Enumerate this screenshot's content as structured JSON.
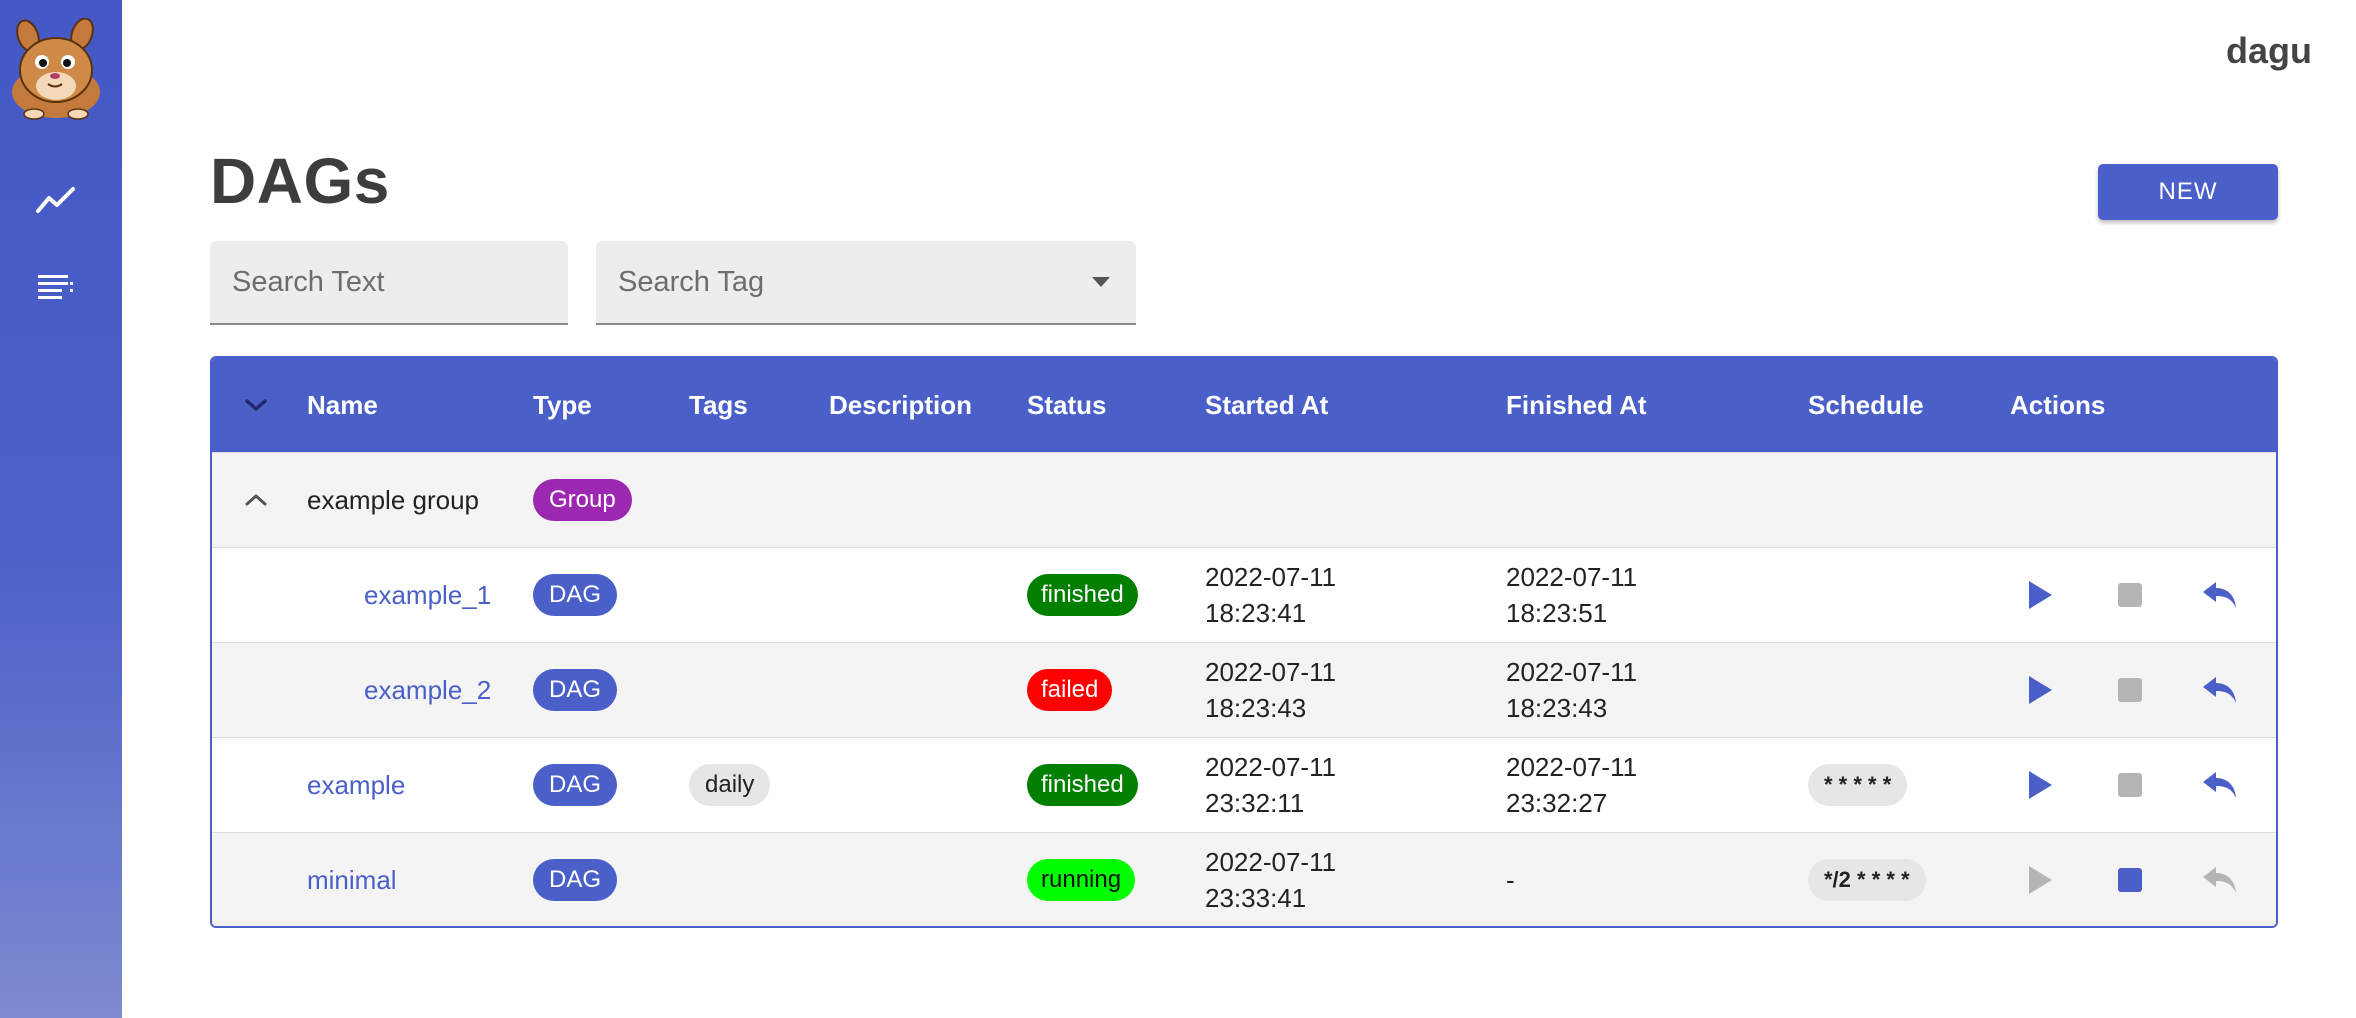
{
  "app": {
    "brand": "dagu"
  },
  "page": {
    "title": "DAGs",
    "new_button": "NEW"
  },
  "search": {
    "text_placeholder": "Search Text",
    "tag_placeholder": "Search Tag"
  },
  "table": {
    "columns": [
      "Name",
      "Type",
      "Tags",
      "Description",
      "Status",
      "Started At",
      "Finished At",
      "Schedule",
      "Actions"
    ],
    "group": {
      "name": "example group",
      "type": "Group"
    },
    "rows": [
      {
        "name": "example_1",
        "type": "DAG",
        "tags": "",
        "status": "finished",
        "started_date": "2022-07-11",
        "started_time": "18:23:41",
        "finished_date": "2022-07-11",
        "finished_time": "18:23:51",
        "schedule": ""
      },
      {
        "name": "example_2",
        "type": "DAG",
        "tags": "",
        "status": "failed",
        "started_date": "2022-07-11",
        "started_time": "18:23:43",
        "finished_date": "2022-07-11",
        "finished_time": "18:23:43",
        "schedule": ""
      },
      {
        "name": "example",
        "type": "DAG",
        "tags": "daily",
        "status": "finished",
        "started_date": "2022-07-11",
        "started_time": "23:32:11",
        "finished_date": "2022-07-11",
        "finished_time": "23:32:27",
        "schedule": "* * * * *"
      },
      {
        "name": "minimal",
        "type": "DAG",
        "tags": "",
        "status": "running",
        "started_date": "2022-07-11",
        "started_time": "23:33:41",
        "finished_date": "-",
        "finished_time": "",
        "schedule": "*/2 * * * *"
      }
    ]
  },
  "colors": {
    "primary": "#4b5fc8",
    "group_chip": "#9c27b0",
    "status_finished": "#018000",
    "status_failed": "#ff0000",
    "status_running": "#00ff00",
    "disabled": "#b5b5b5"
  },
  "icons": [
    "gerbil-logo",
    "dashboard-chart-icon",
    "dag-list-icon",
    "chevron-down-icon",
    "chevron-up-icon",
    "play-icon",
    "stop-icon",
    "retry-icon"
  ]
}
